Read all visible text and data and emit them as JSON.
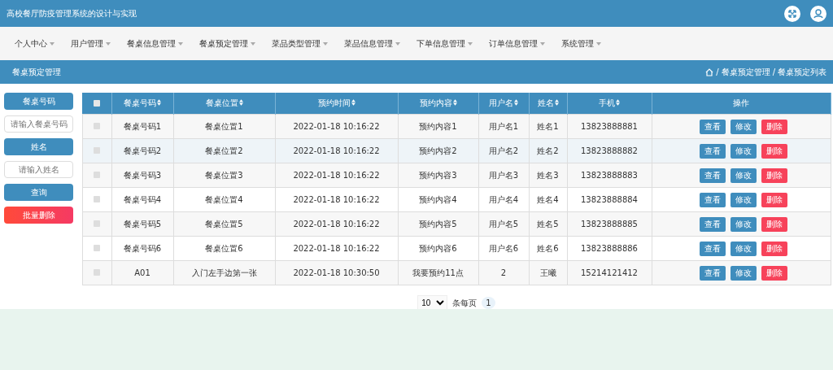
{
  "header": {
    "title": "高校餐厅防疫管理系统的设计与实现"
  },
  "nav": [
    {
      "label": "个人中心"
    },
    {
      "label": "用户管理"
    },
    {
      "label": "餐桌信息管理"
    },
    {
      "label": "餐桌预定管理"
    },
    {
      "label": "菜品类型管理"
    },
    {
      "label": "菜品信息管理"
    },
    {
      "label": "下单信息管理"
    },
    {
      "label": "订单信息管理"
    },
    {
      "label": "系统管理"
    }
  ],
  "page_title": "餐桌预定管理",
  "breadcrumb": [
    {
      "separator": "/",
      "label": "餐桌预定管理"
    },
    {
      "separator": "/",
      "label": "餐桌预定列表"
    }
  ],
  "search": [
    {
      "label": "餐桌号码",
      "placeholder": "请输入餐桌号码"
    },
    {
      "label": "姓名",
      "placeholder": "请输入姓名"
    }
  ],
  "query_button": "查询",
  "batch_delete_button": "批量删除",
  "table": {
    "select_all_checked": false,
    "columns": [
      "餐桌号码",
      "餐桌位置",
      "预约时间",
      "预约内容",
      "用户名",
      "姓名",
      "手机",
      "操作"
    ],
    "rows": [
      {
        "checked": false,
        "cells": [
          "餐桌号码1",
          "餐桌位置1",
          "2022-01-18 10:16:22",
          "预约内容1",
          "用户名1",
          "姓名1",
          "13823888881"
        ],
        "actions": [
          "查看",
          "修改",
          "删除"
        ]
      },
      {
        "checked": false,
        "cells": [
          "餐桌号码2",
          "餐桌位置2",
          "2022-01-18 10:16:22",
          "预约内容2",
          "用户名2",
          "姓名2",
          "13823888882"
        ],
        "actions": [
          "查看",
          "修改",
          "删除"
        ]
      },
      {
        "checked": false,
        "cells": [
          "餐桌号码3",
          "餐桌位置3",
          "2022-01-18 10:16:22",
          "预约内容3",
          "用户名3",
          "姓名3",
          "13823888883"
        ],
        "actions": [
          "查看",
          "修改",
          "删除"
        ]
      },
      {
        "checked": false,
        "cells": [
          "餐桌号码4",
          "餐桌位置4",
          "2022-01-18 10:16:22",
          "预约内容4",
          "用户名4",
          "姓名4",
          "13823888884"
        ],
        "actions": [
          "查看",
          "修改",
          "删除"
        ]
      },
      {
        "checked": false,
        "cells": [
          "餐桌号码5",
          "餐桌位置5",
          "2022-01-18 10:16:22",
          "预约内容5",
          "用户名5",
          "姓名5",
          "13823888885"
        ],
        "actions": [
          "查看",
          "修改",
          "删除"
        ]
      },
      {
        "checked": false,
        "cells": [
          "餐桌号码6",
          "餐桌位置6",
          "2022-01-18 10:16:22",
          "预约内容6",
          "用户名6",
          "姓名6",
          "13823888886"
        ],
        "actions": [
          "查看",
          "修改",
          "删除"
        ]
      },
      {
        "checked": false,
        "cells": [
          "A01",
          "入门左手边第一张",
          "2022-01-18 10:30:50",
          "我要预约11点",
          "2",
          "王曦",
          "15214121412"
        ],
        "actions": [
          "查看",
          "修改",
          "删除"
        ]
      }
    ]
  },
  "pagination": {
    "page_size": "10",
    "page_size_label": "条每页",
    "pages": [
      {
        "label": "1",
        "selected": true
      }
    ]
  }
}
